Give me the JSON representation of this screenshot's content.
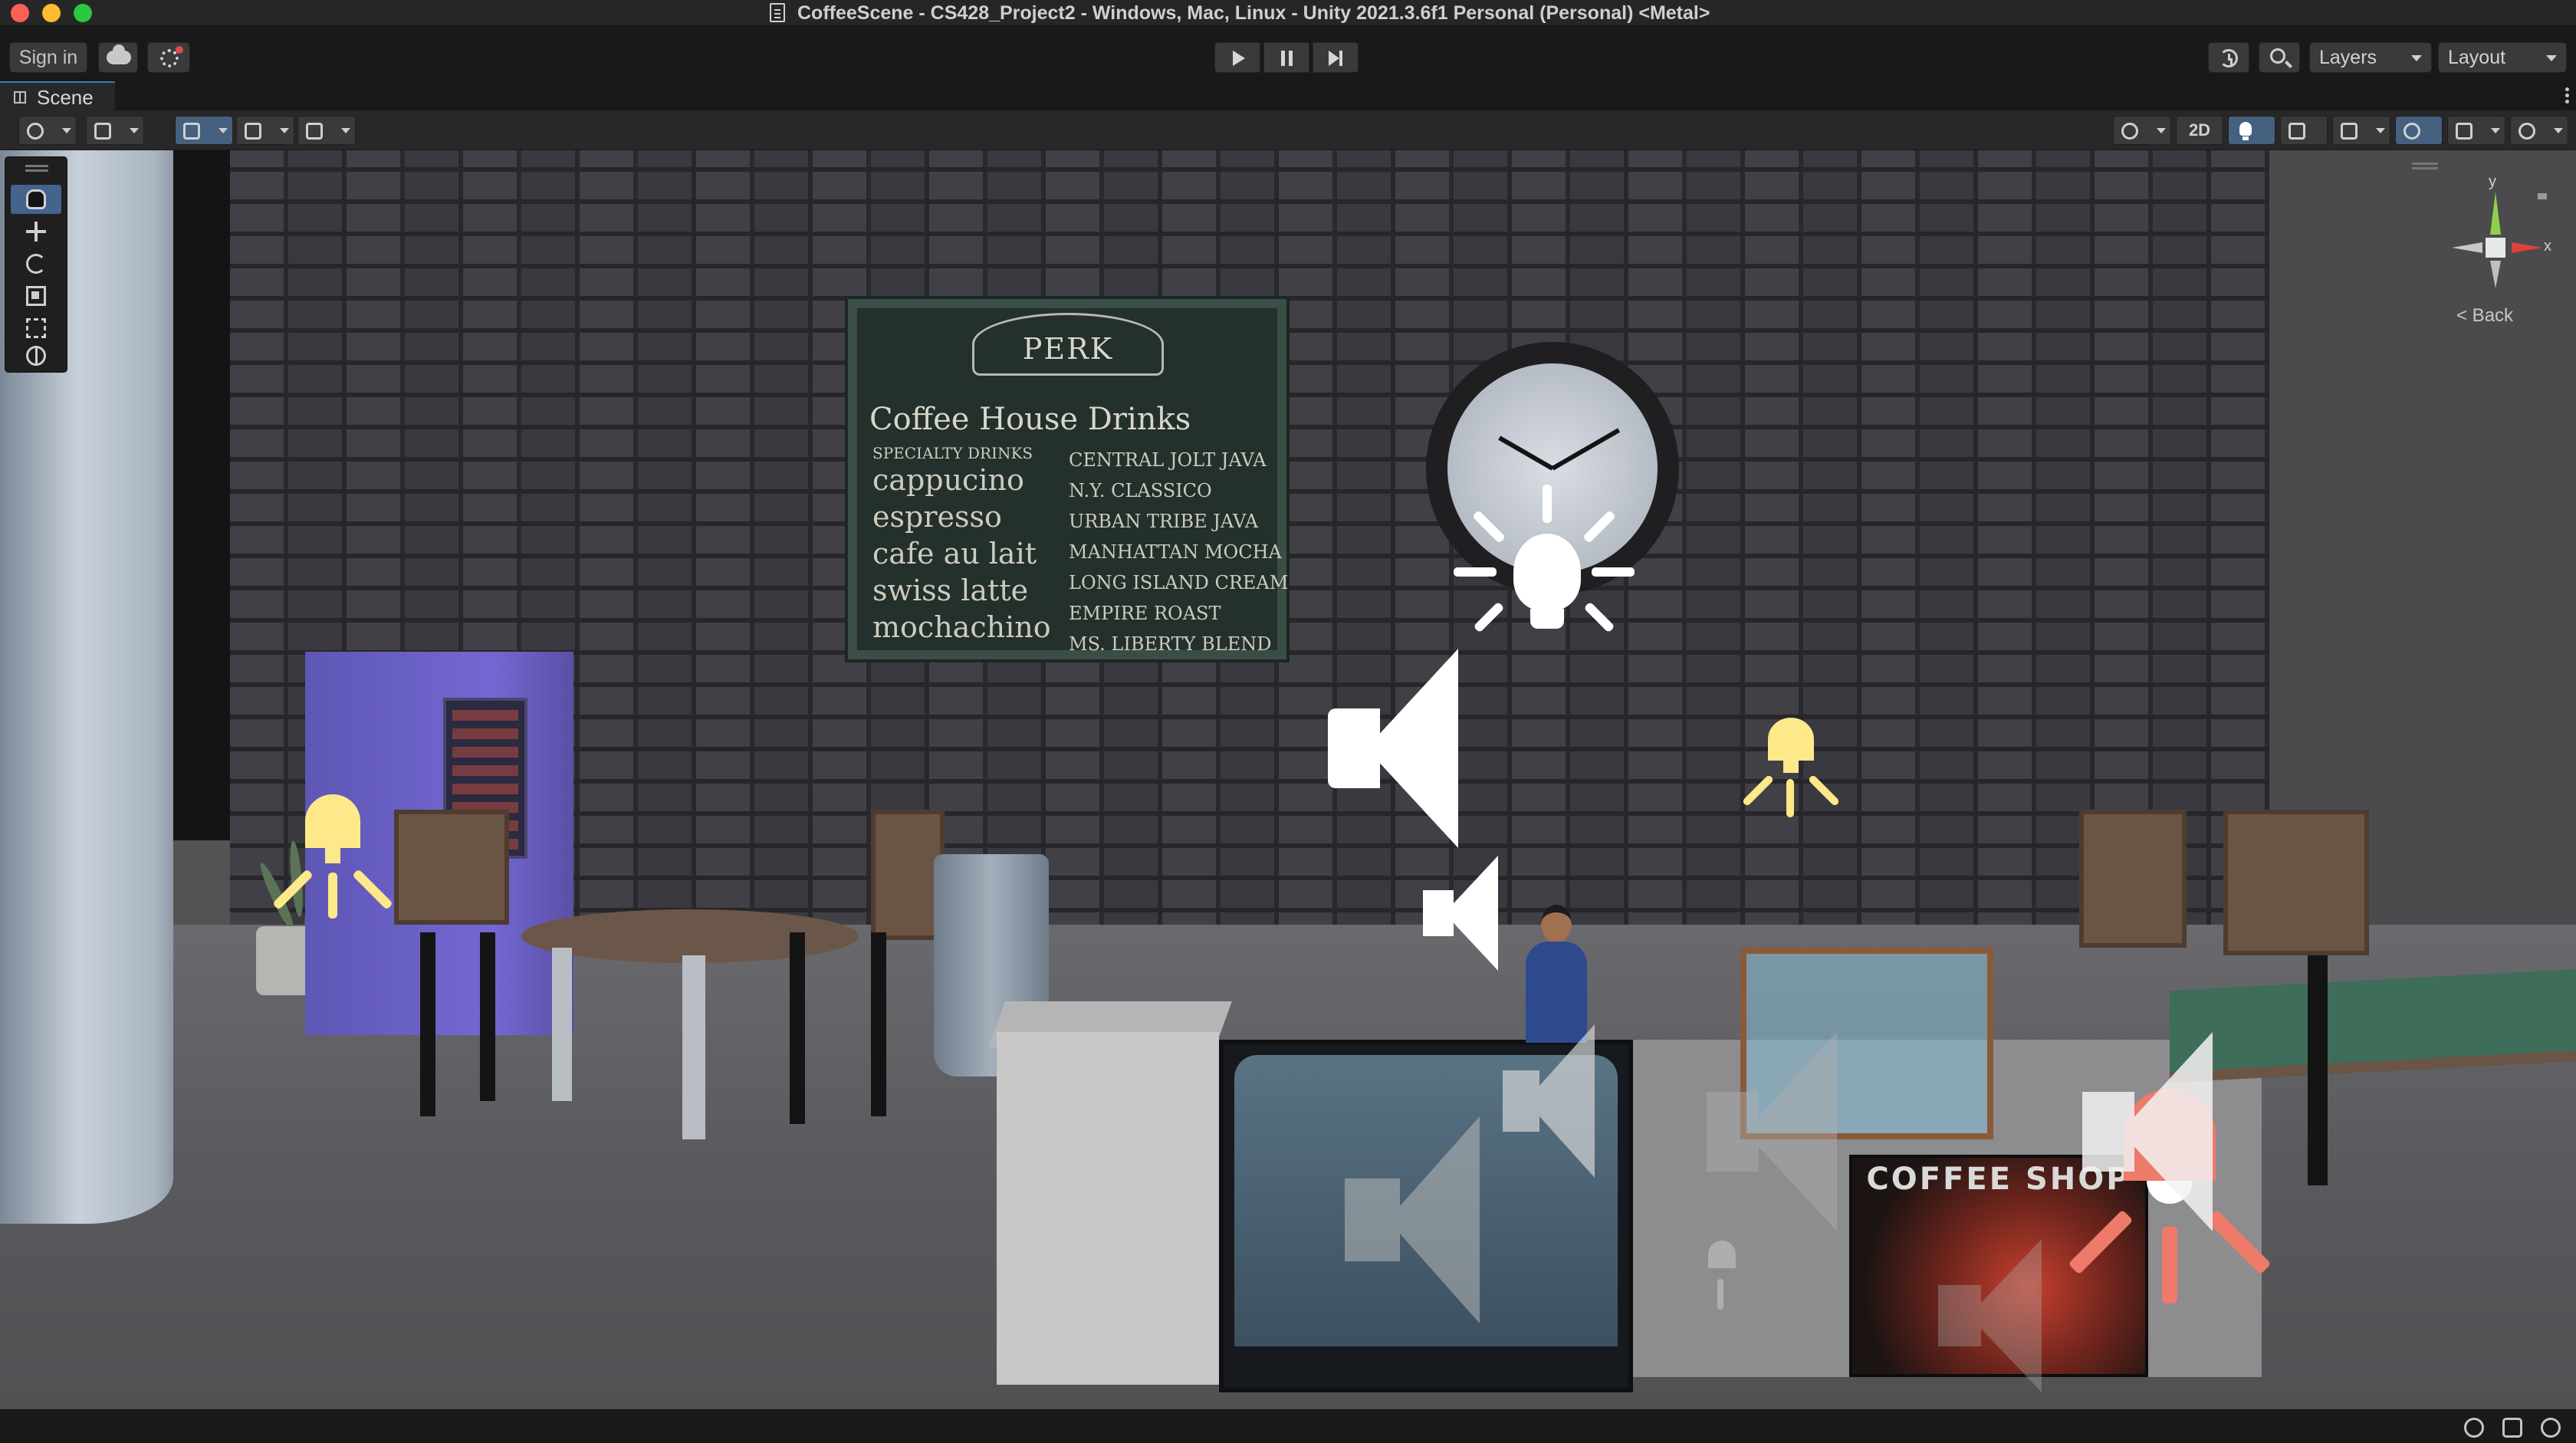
{
  "window": {
    "title": "CoffeeScene - CS428_Project2 - Windows, Mac, Linux - Unity 2021.3.6f1 Personal (Personal) <Metal>"
  },
  "toolbar": {
    "sign_in_label": "Sign in",
    "layers_label": "Layers",
    "layout_label": "Layout"
  },
  "scene_tab": {
    "label": "Scene"
  },
  "scene_toolbar": {
    "mode_2d_label": "2D"
  },
  "scene_gizmo": {
    "y_label": "y",
    "x_label": "x",
    "back_label": "< Back"
  },
  "scene": {
    "menu_board": {
      "logo_text": "PERK",
      "heading": "Coffee House Drinks",
      "specialty_label": "SPECIALTY DRINKS",
      "left_items": [
        "cappucino",
        "espresso",
        "cafe au lait",
        "swiss latte",
        "mochachino"
      ],
      "right_items": [
        "CENTRAL JOLT JAVA",
        "N.Y. CLASSICO",
        "URBAN TRIBE JAVA",
        "MANHATTAN MOCHA",
        "LONG ISLAND CREAM",
        "EMPIRE ROAST",
        "MS. LIBERTY BLEND"
      ]
    },
    "poster": {
      "title": "COFFEE SHOP"
    }
  },
  "colors": {
    "accent_tab": "#3a79bb",
    "light_yellow": "#fde98a",
    "light_orange": "#ee7a6a",
    "tool_active": "#44638e"
  }
}
